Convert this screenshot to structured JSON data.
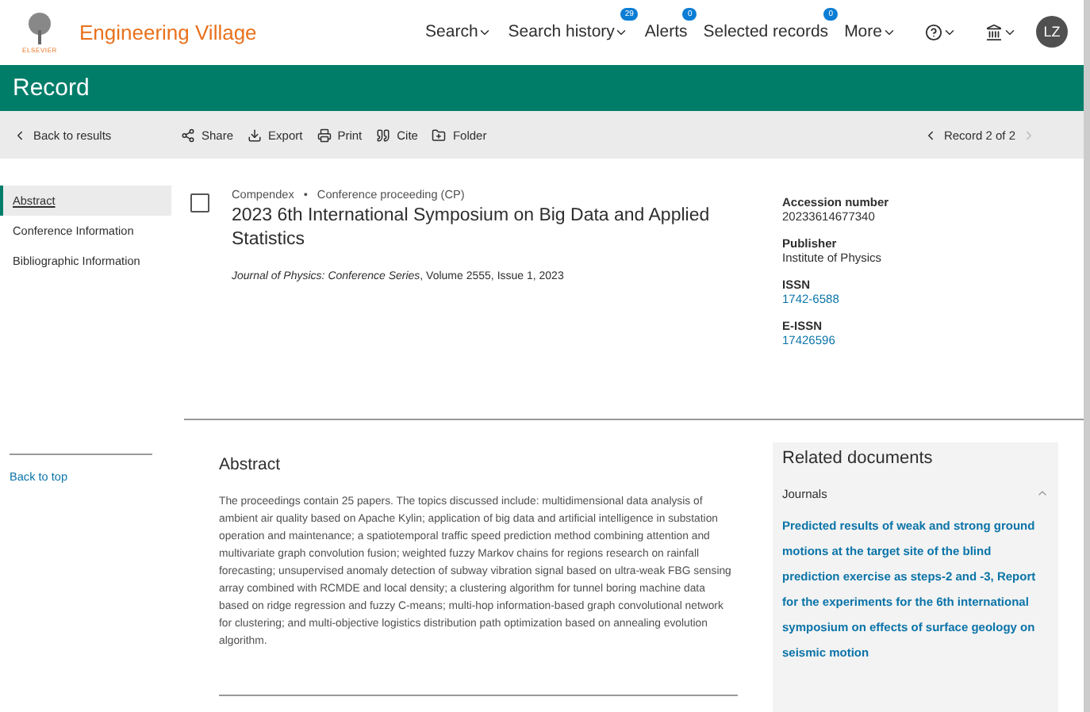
{
  "header": {
    "brand": "Engineering Village",
    "logo_text": "ELSEVIER",
    "nav": [
      {
        "label": "Search",
        "kind": "menu"
      },
      {
        "label": "Search history",
        "kind": "menu",
        "badge": "29"
      },
      {
        "label": "Alerts",
        "kind": "link",
        "badge": "0"
      },
      {
        "label": "Selected records",
        "kind": "link",
        "badge": "0"
      },
      {
        "label": "More",
        "kind": "menu"
      },
      {
        "kind": "help"
      },
      {
        "kind": "institution"
      }
    ],
    "avatar": "LZ"
  },
  "banner": {
    "title": "Record"
  },
  "toolbar": {
    "back": "Back to results",
    "actions": [
      {
        "label": "Share",
        "kind": "share"
      },
      {
        "label": "Export",
        "kind": "export"
      },
      {
        "label": "Print",
        "kind": "print"
      },
      {
        "label": "Cite",
        "kind": "cite"
      },
      {
        "label": "Folder",
        "kind": "folder"
      }
    ],
    "pager": "Record 2 of 2"
  },
  "sidebar": {
    "items": [
      {
        "label": "Abstract",
        "selected": true
      },
      {
        "label": "Conference Information",
        "selected": false
      },
      {
        "label": "Bibliographic Information",
        "selected": false
      }
    ],
    "back_to_top": "Back to top"
  },
  "record": {
    "checked": false,
    "source": "Compendex",
    "separator": "•",
    "doc_type": "Conference proceeding (CP)",
    "title": "2023 6th International Symposium on Big Data and Applied Statistics",
    "citation": "*Journal of Physics: Conference Series*, Volume 2555, Issue 1, 2023"
  },
  "details": [
    {
      "label": "Accession number",
      "value": "20233614677340",
      "link": false
    },
    {
      "label": "Publisher",
      "value": "Institute of Physics",
      "link": false
    },
    {
      "label": "ISSN",
      "value": "1742-6588",
      "link": true
    },
    {
      "label": "E-ISSN",
      "value": "17426596",
      "link": true
    }
  ],
  "abstract": {
    "heading": "Abstract",
    "text": "The proceedings contain 25 papers. The topics discussed include: multidimensional data analysis of ambient air quality based on Apache Kylin; application of big data and artificial intelligence in substation operation and maintenance; a spatiotemporal traffic speed prediction method combining attention and multivariate graph convolution fusion; weighted fuzzy Markov chains for regions research on rainfall forecasting; unsupervised anomaly detection of subway vibration signal based on ultra-weak FBG sensing array combined with RCMDE and local density; a clustering algorithm for tunnel boring machine data based on ridge regression and fuzzy C-means; multi-hop information-based graph convolutional network for clustering; and multi-objective logistics distribution path optimization based on annealing evolution algorithm."
  },
  "related": {
    "title": "Related documents",
    "section": {
      "label": "Journals",
      "expanded": true
    },
    "items": [
      "Predicted results of weak and strong ground motions at the target site of the blind prediction exercise as steps-2 and -3, Report for the experiments for the 6th international symposium on effects of surface geology on seismic motion"
    ]
  }
}
